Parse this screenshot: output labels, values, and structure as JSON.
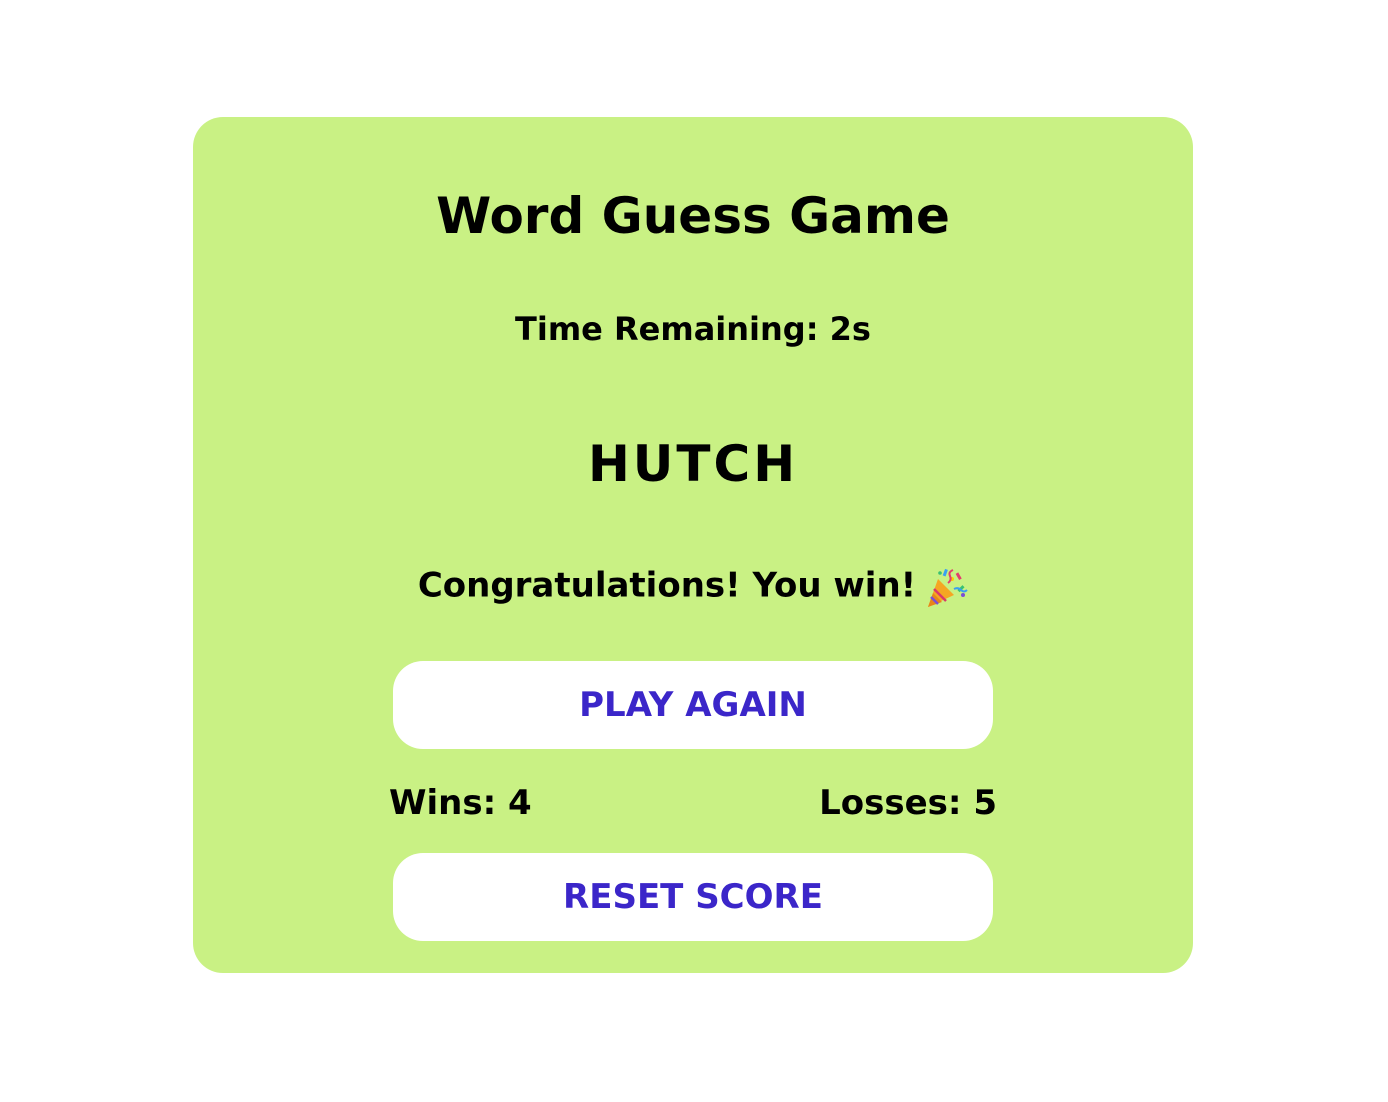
{
  "game": {
    "title": "Word Guess Game",
    "time_remaining": "Time Remaining: 2s",
    "word": "HUTCH",
    "message": "Congratulations! You win!",
    "message_icon": "party-popper-icon"
  },
  "buttons": {
    "play_again": "PLAY AGAIN",
    "reset_score": "RESET SCORE"
  },
  "score": {
    "wins": "Wins: 4",
    "losses": "Losses: 5"
  },
  "colors": {
    "card_background": "#c9f184",
    "button_background": "#ffffff",
    "button_text": "#3b26c9",
    "text": "#000000"
  }
}
